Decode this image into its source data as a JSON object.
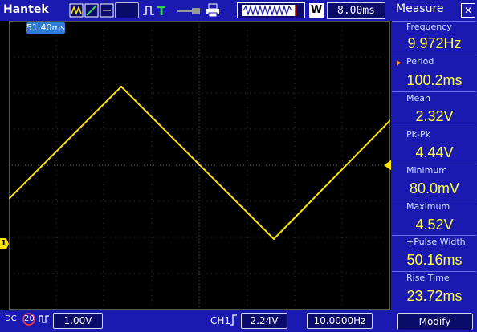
{
  "brand": "Hantek",
  "toolbar": {
    "timebase": "8.00ms",
    "w_label": "W"
  },
  "screen": {
    "time_tag": "51.40ms",
    "channel_marker": "1"
  },
  "measure": {
    "title": "Measure",
    "close": "✕",
    "items": [
      {
        "label": "Frequency",
        "value": "9.972Hz"
      },
      {
        "label": "Period",
        "value": "100.2ms"
      },
      {
        "label": "Mean",
        "value": "2.32V"
      },
      {
        "label": "Pk-Pk",
        "value": "4.44V"
      },
      {
        "label": "Minimum",
        "value": "80.0mV"
      },
      {
        "label": "Maximum",
        "value": "4.52V"
      },
      {
        "label": "+Pulse Width",
        "value": "50.16ms"
      },
      {
        "label": "Rise Time",
        "value": "23.72ms"
      }
    ],
    "modify": "Modify"
  },
  "bottom": {
    "coupling": "DC",
    "bw_limit": "20",
    "volts_div": "1.00V",
    "trigger_channel": "CH1",
    "trigger_level": "2.24V",
    "trigger_freq": "10.0000Hz"
  },
  "colors": {
    "trace": "#ffe600",
    "panel": "#1a1ab0",
    "value": "#ffff3a"
  },
  "icons": [
    "waveform-icon",
    "stop-icon",
    "run-icon",
    "trigger-icon",
    "print-icon"
  ]
}
